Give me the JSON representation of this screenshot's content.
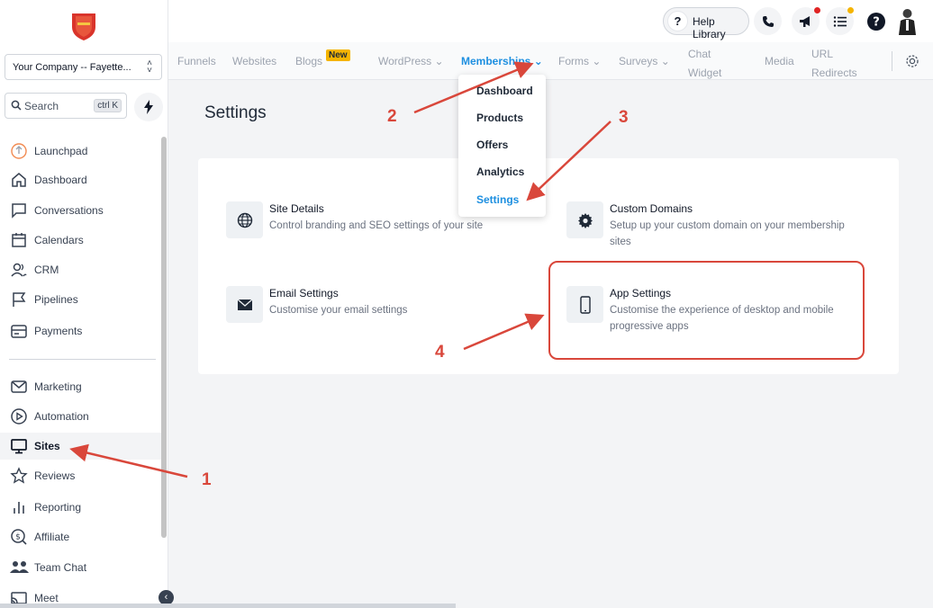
{
  "sidebar": {
    "company": "Your Company -- Fayette...",
    "search_label": "Search",
    "search_shortcut": "ctrl K",
    "items": [
      {
        "label": "Launchpad",
        "icon": "launchpad-icon"
      },
      {
        "label": "Dashboard",
        "icon": "home-icon"
      },
      {
        "label": "Conversations",
        "icon": "chat-icon"
      },
      {
        "label": "Calendars",
        "icon": "calendar-icon"
      },
      {
        "label": "CRM",
        "icon": "contacts-icon"
      },
      {
        "label": "Pipelines",
        "icon": "flag-icon"
      },
      {
        "label": "Payments",
        "icon": "payment-icon"
      },
      {
        "label": "Marketing",
        "icon": "mail-icon"
      },
      {
        "label": "Automation",
        "icon": "play-icon"
      },
      {
        "label": "Sites",
        "icon": "monitor-icon"
      },
      {
        "label": "Reviews",
        "icon": "star-icon"
      },
      {
        "label": "Reporting",
        "icon": "bar-chart-icon"
      },
      {
        "label": "Affiliate",
        "icon": "dollar-icon"
      },
      {
        "label": "Team Chat",
        "icon": "team-icon"
      },
      {
        "label": "Meet",
        "icon": "cast-icon"
      }
    ],
    "active_item": "Sites"
  },
  "header": {
    "help_label": "Help Library"
  },
  "subnav": {
    "items": [
      {
        "label": "Funnels"
      },
      {
        "label": "Websites"
      },
      {
        "label": "Blogs"
      },
      {
        "label": "WordPress"
      },
      {
        "label": "Memberships"
      },
      {
        "label": "Forms"
      },
      {
        "label": "Surveys"
      },
      {
        "label": "Chat"
      },
      {
        "label": "Widget"
      },
      {
        "label": "Media"
      },
      {
        "label": "URL"
      },
      {
        "label": "Redirects"
      }
    ],
    "new_badge": "New",
    "active": "Memberships"
  },
  "dropdown": {
    "items": [
      "Dashboard",
      "Products",
      "Offers",
      "Analytics",
      "Settings"
    ],
    "selected": "Settings"
  },
  "main": {
    "title": "Settings",
    "options": [
      {
        "title": "Site Details",
        "desc": "Control branding and SEO settings of your site"
      },
      {
        "title": "Custom Domains",
        "desc1": "Setup up your custom domain on your membership",
        "desc2": "sites"
      },
      {
        "title": "Email Settings",
        "desc": "Customise your email settings"
      },
      {
        "title": "App Settings",
        "desc1": "Customise the experience of desktop and mobile",
        "desc2": "progressive apps"
      }
    ]
  },
  "annotations": [
    "1",
    "2",
    "3",
    "4"
  ],
  "colors": {
    "accent": "#1d8fe0",
    "annotation": "#d9473b",
    "new_badge": "#f5b400"
  }
}
